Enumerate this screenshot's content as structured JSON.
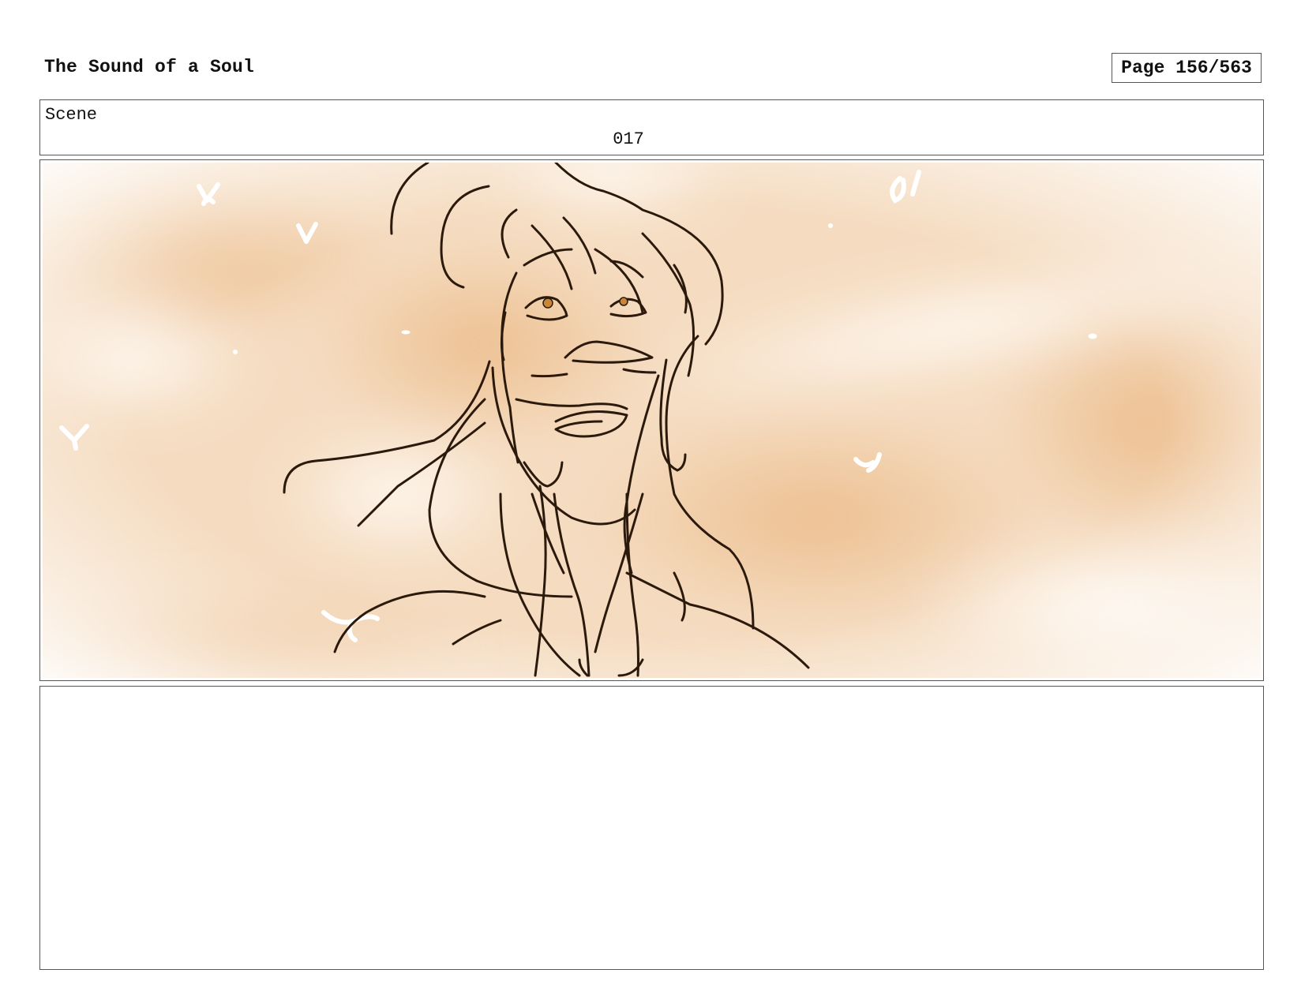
{
  "header": {
    "title": "The Sound of a Soul",
    "page": "Page 156/563"
  },
  "scene": {
    "label": "Scene",
    "number": "017"
  },
  "panel": {
    "subject": "storyboard-sketch-character-face",
    "colors": {
      "background_warm": "#f0c597",
      "background_light": "#fdf5ec",
      "line": "#2b1a0c",
      "sparkle": "#ffffff",
      "eye": "#c98638"
    }
  },
  "notes": {
    "text": ""
  }
}
